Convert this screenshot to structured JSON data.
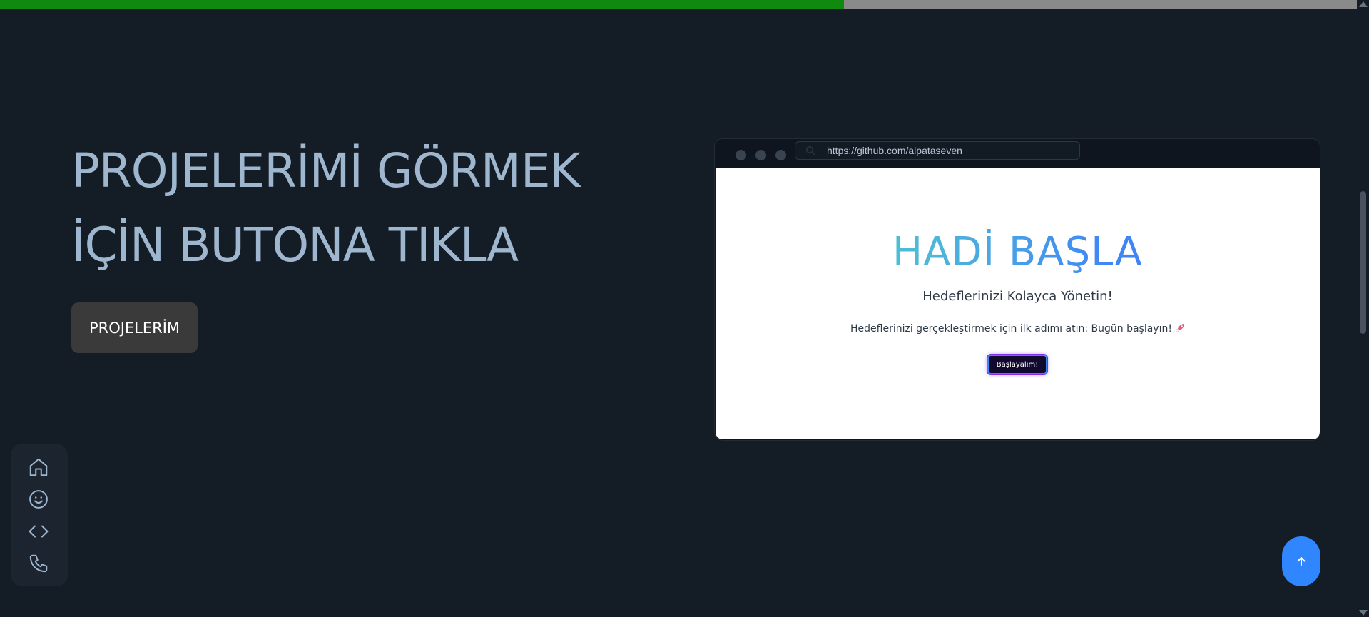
{
  "progress": {
    "value_percent": 62.2,
    "fill_color": "#0f8a0f",
    "track_color": "#8a8a8a"
  },
  "hero": {
    "title_line1": "PROJELERİMİ GÖRMEK",
    "title_line2": "İÇİN BUTONA TIKLA",
    "button_label": "PROJELERİM"
  },
  "browser_preview": {
    "url": "https://github.com/alpataseven",
    "heading": "HADİ BAŞLA",
    "subtitle": "Hedeflerinizi Kolayca Yönetin!",
    "text": "Hedeflerinizi gerçekleştirmek için ilk adımı atın: Bugün başlayın!",
    "button_label": "Başlayalım!",
    "gradient_colors": [
      "#3fd9c0",
      "#3f7cf5"
    ]
  },
  "side_nav": {
    "items": [
      {
        "icon": "home-icon"
      },
      {
        "icon": "smile-icon"
      },
      {
        "icon": "code-icon"
      },
      {
        "icon": "phone-icon"
      }
    ]
  },
  "scroll_top": {
    "icon": "arrow-up-icon",
    "color": "#2f86ff"
  }
}
